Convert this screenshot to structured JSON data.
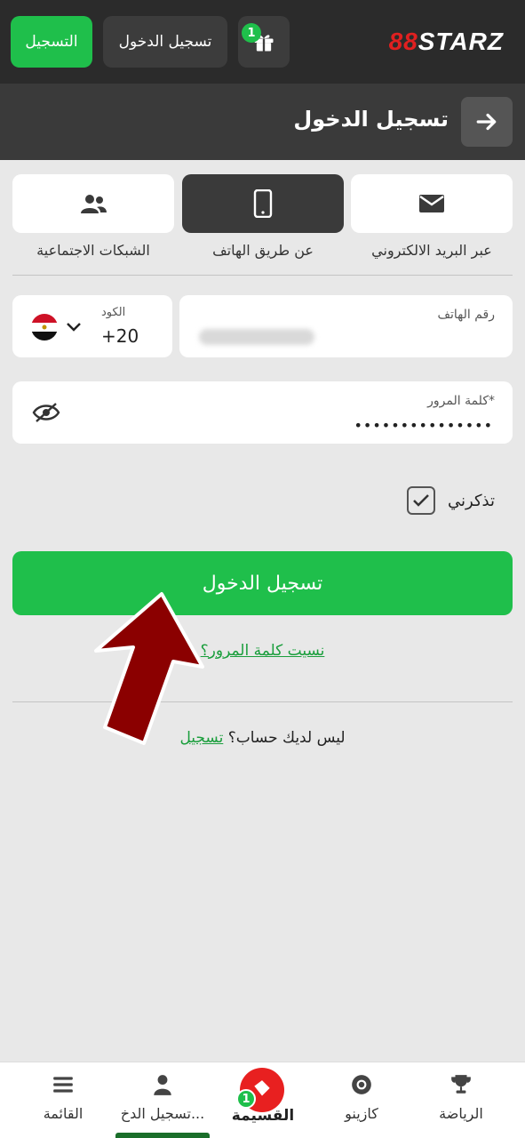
{
  "topbar": {
    "register_label": "التسجيل",
    "login_label": "تسجيل الدخول",
    "gift_badge": "1",
    "logo_prefix": "88",
    "logo_text": "STARZ",
    "accent": "#1fbf4b",
    "logo_red": "#e02020"
  },
  "header": {
    "title": "تسجيل الدخول"
  },
  "tabs": [
    {
      "label": "عبر البريد الالكتروني",
      "icon": "envelope-icon"
    },
    {
      "label": "عن طريق الهاتف",
      "icon": "phone-icon"
    },
    {
      "label": "الشبكات الاجتماعية",
      "icon": "users-icon"
    }
  ],
  "form": {
    "phone_label": "رقم الهاتف",
    "code_label": "الكود",
    "code_value": "+20",
    "password_label": "كلمة المرور*",
    "password_value": "•••••••••••••••",
    "remember_label": "تذكرني",
    "login_button": "تسجيل الدخول",
    "forgot_link": "نسيت كلمة المرور؟",
    "no_account_text": "ليس لديك حساب؟",
    "register_link": "تسجيل"
  },
  "bottom_nav": {
    "sports": "الرياضة",
    "casino": "كازينو",
    "coupon": "القسيمة",
    "coupon_badge": "1",
    "login": "تسجيل الدخ...",
    "menu": "القائمة"
  }
}
